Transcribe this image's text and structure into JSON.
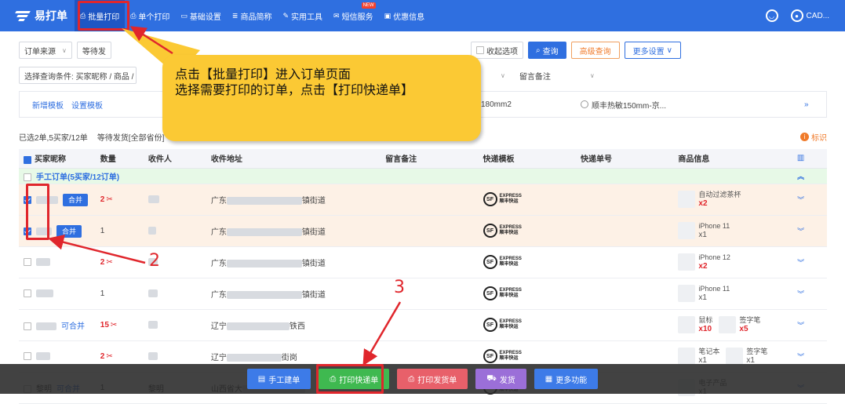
{
  "topbar": {
    "brand": "易打单",
    "nav": [
      {
        "label": "批量打印",
        "icon": "printer-icon"
      },
      {
        "label": "单个打印",
        "icon": "printer-icon"
      },
      {
        "label": "基础设置",
        "icon": "monitor-icon"
      },
      {
        "label": "商品简称",
        "icon": "list-icon"
      },
      {
        "label": "实用工具",
        "icon": "wrench-icon"
      },
      {
        "label": "短信服务",
        "icon": "mail-icon",
        "badge": "NEW"
      },
      {
        "label": "优惠信息",
        "icon": "card-icon"
      }
    ],
    "user": "CAD..."
  },
  "filters": {
    "source_label": "订单来源",
    "status_label": "等待发",
    "collapse_label": "收起选项",
    "query_label": "查询",
    "advanced_label": "高级查询",
    "more_settings_label": "更多设置",
    "condition_label": "选择查询条件: 买家昵称 / 商品 /",
    "remark_label": "留言备注"
  },
  "templates": {
    "add_label": "新增模板",
    "settings_label": "设置模板",
    "size_label": "180mm2",
    "sf_option": "顺丰热敏150mm-京..."
  },
  "summary": {
    "selected": "已选2单,5买家/12单",
    "status": "等待发货[全部省份]",
    "mark_label": "标识"
  },
  "table": {
    "headers": [
      "买家昵称",
      "数量",
      "收件人",
      "收件地址",
      "留言备注",
      "快递模板",
      "快递单号",
      "商品信息"
    ],
    "group_label": "手工订单(5买家/12订单)",
    "merge_button": "合并",
    "merge_link": "可合并",
    "rows": [
      {
        "checked": true,
        "merge": "button",
        "qty": "2",
        "qty_split": true,
        "addr_prov": "广东",
        "addr_end": "镇街道",
        "products": [
          {
            "name": "自动过滤茶杯",
            "count": "x2",
            "red": true
          }
        ],
        "orange": true
      },
      {
        "checked": true,
        "merge": "button",
        "qty": "1",
        "qty_split": false,
        "addr_prov": "广东",
        "addr_end": "镇街道",
        "products": [
          {
            "name": "iPhone 11",
            "count": "x1",
            "red": false
          }
        ],
        "orange": true
      },
      {
        "checked": false,
        "merge": "none",
        "qty": "2",
        "qty_split": true,
        "addr_prov": "广东",
        "addr_end": "镇街道",
        "products": [
          {
            "name": "iPhone 12",
            "count": "x2",
            "red": true
          }
        ],
        "orange": false
      },
      {
        "checked": false,
        "merge": "none",
        "qty": "1",
        "qty_split": false,
        "addr_prov": "广东",
        "addr_end": "镇街道",
        "products": [
          {
            "name": "iPhone 11",
            "count": "x1",
            "red": false
          }
        ],
        "orange": false
      },
      {
        "checked": false,
        "merge": "link",
        "qty": "15",
        "qty_split": true,
        "addr_prov": "辽宁",
        "addr_end": "铁西",
        "products": [
          {
            "name": "鼠标",
            "count": "x10",
            "red": true
          },
          {
            "name": "签字笔",
            "count": "x5",
            "red": true
          }
        ],
        "orange": false
      },
      {
        "checked": false,
        "merge": "none",
        "qty": "2",
        "qty_split": true,
        "addr_prov": "辽宁",
        "addr_end": "街岗",
        "products": [
          {
            "name": "笔记本",
            "count": "x1",
            "red": false
          },
          {
            "name": "签字笔",
            "count": "x1",
            "red": false
          }
        ],
        "orange": false
      },
      {
        "checked": false,
        "merge": "link",
        "buyer": "黎明",
        "recipient": "黎明",
        "qty": "1",
        "qty_split": false,
        "addr_prov": "山西省大",
        "addr_end": "",
        "products": [
          {
            "name": "电子产品",
            "count": "x1",
            "red": false
          }
        ],
        "orange": false
      }
    ],
    "express_logo": "SF",
    "express_text_top": "EXPRESS",
    "express_text_bottom": "顺丰快运"
  },
  "bottombar": {
    "buttons": [
      {
        "label": "手工建单",
        "color": "#3d7be8"
      },
      {
        "label": "打印快递单",
        "color": "#3fb950"
      },
      {
        "label": "打印发货单",
        "color": "#e8606a"
      },
      {
        "label": "发货",
        "color": "#9b6fd8"
      },
      {
        "label": "更多功能",
        "color": "#3d7be8"
      }
    ]
  },
  "annotation": {
    "line1": "点击【批量打印】进入订单页面",
    "line2": "选择需要打印的订单，点击【打印快递单】",
    "num2": "2",
    "num3": "3"
  }
}
